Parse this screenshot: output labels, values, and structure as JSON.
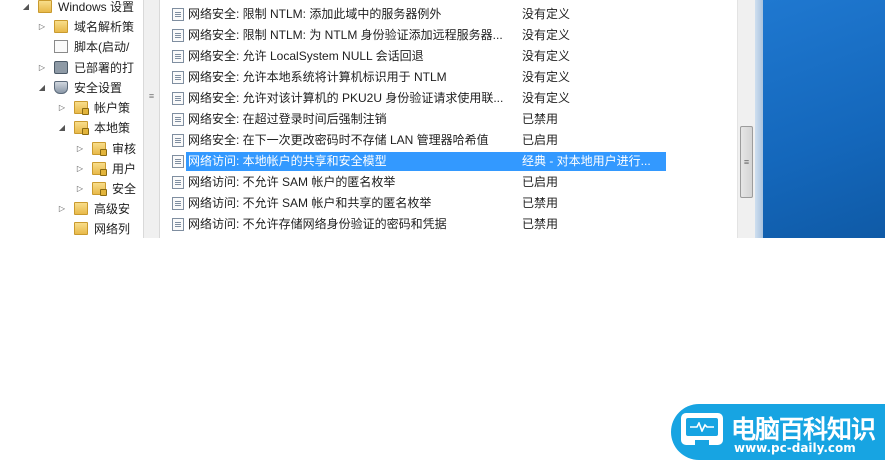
{
  "tree": {
    "items": [
      {
        "label": "Windows 设置",
        "arrow": "◢",
        "icon": "folder-icon"
      },
      {
        "label": "域名解析策",
        "arrow": "▷",
        "icon": "folder-icon"
      },
      {
        "label": "脚本(启动/",
        "arrow": "",
        "icon": "script-icon"
      },
      {
        "label": "已部署的打",
        "arrow": "▷",
        "icon": "printer-icon"
      },
      {
        "label": "安全设置",
        "arrow": "◢",
        "icon": "shield-icon"
      },
      {
        "label": "帐户策",
        "arrow": "▷",
        "icon": "folder-lock-icon"
      },
      {
        "label": "本地策",
        "arrow": "◢",
        "icon": "folder-lock-icon"
      },
      {
        "label": "审核",
        "arrow": "▷",
        "icon": "folder-lock-icon"
      },
      {
        "label": "用户",
        "arrow": "▷",
        "icon": "folder-lock-icon"
      },
      {
        "label": "安全",
        "arrow": "▷",
        "icon": "folder-lock-icon"
      },
      {
        "label": "高级安",
        "arrow": "▷",
        "icon": "folder-icon"
      },
      {
        "label": "网络列",
        "arrow": "",
        "icon": "folder-icon"
      }
    ]
  },
  "policies": [
    {
      "name": "网络安全: 限制 NTLM: 添加此域中的服务器例外",
      "value": "没有定义",
      "selected": false
    },
    {
      "name": "网络安全: 限制 NTLM: 为 NTLM 身份验证添加远程服务器...",
      "value": "没有定义",
      "selected": false
    },
    {
      "name": "网络安全: 允许 LocalSystem NULL 会话回退",
      "value": "没有定义",
      "selected": false
    },
    {
      "name": "网络安全: 允许本地系统将计算机标识用于 NTLM",
      "value": "没有定义",
      "selected": false
    },
    {
      "name": "网络安全: 允许对该计算机的 PKU2U 身份验证请求使用联...",
      "value": "没有定义",
      "selected": false
    },
    {
      "name": "网络安全: 在超过登录时间后强制注销",
      "value": "已禁用",
      "selected": false
    },
    {
      "name": "网络安全: 在下一次更改密码时不存储 LAN 管理器哈希值",
      "value": "已启用",
      "selected": false
    },
    {
      "name": "网络访问: 本地帐户的共享和安全模型",
      "value": "经典 - 对本地用户进行...",
      "selected": true
    },
    {
      "name": "网络访问: 不允许 SAM 帐户的匿名枚举",
      "value": "已启用",
      "selected": false
    },
    {
      "name": "网络访问: 不允许 SAM 帐户和共享的匿名枚举",
      "value": "已禁用",
      "selected": false
    },
    {
      "name": "网络访问: 不允许存储网络身份验证的密码和凭据",
      "value": "已禁用",
      "selected": false
    }
  ],
  "scroll_grip": "≡",
  "watermark": {
    "cn": "电脑百科知识",
    "en": "www.pc-daily.com",
    "color": "#17a4e2"
  }
}
